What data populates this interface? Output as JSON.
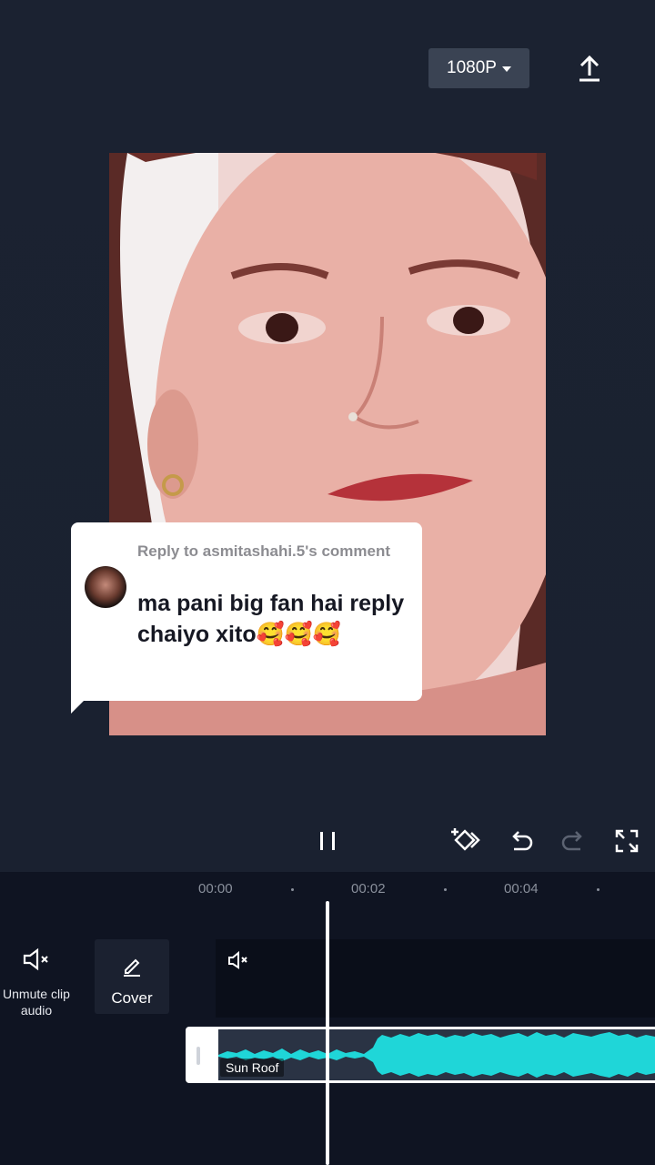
{
  "header": {
    "resolution_label": "1080P",
    "export_icon": "upload-icon"
  },
  "comment_bubble": {
    "reply_to": "Reply to asmitashahi.5's comment",
    "comment_text": "ma pani big fan hai reply chaiyo xito🥰🥰🥰"
  },
  "controls": {
    "play_state_icon": "pause-icon",
    "keyframe_icon": "keyframe-icon",
    "undo_icon": "undo-icon",
    "redo_icon": "redo-icon",
    "fullscreen_icon": "fullscreen-icon"
  },
  "timeline": {
    "time_marks": [
      "00:00",
      "00:02",
      "00:04"
    ],
    "unmute_label": "Unmute clip audio",
    "cover_label": "Cover",
    "audio_track_name": "Sun Roof"
  },
  "colors": {
    "background": "#1a2030",
    "waveform": "#1fd6d8",
    "panel": "#0f1422"
  }
}
